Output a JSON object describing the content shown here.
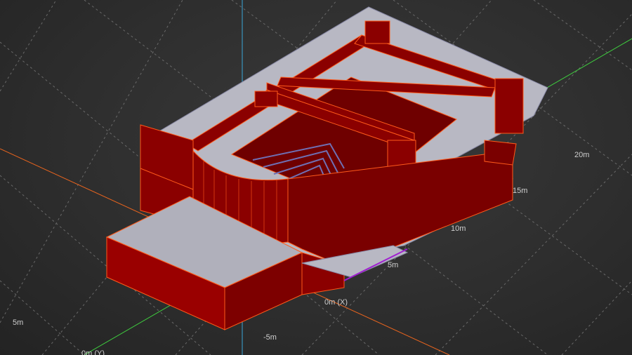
{
  "viewport": {
    "background": "#2e2e2e",
    "grid_color": "#5a5a5a",
    "model_fill": "#8b0000",
    "model_edge": "#ff5a1a",
    "floor_fill": "#b9b9c4"
  },
  "grid_labels": {
    "y_20": "20m",
    "y_15": "15m",
    "y_10": "10m",
    "y_5": "5m",
    "y_0_axis": "0m (X)",
    "y_neg5": "-5m",
    "x_5": "5m",
    "x_0_axis": "0m (Y)"
  },
  "axes": {
    "x_color": "#ff6a1a",
    "y_color": "#3ad13a",
    "z_color": "#2aa6d6"
  }
}
